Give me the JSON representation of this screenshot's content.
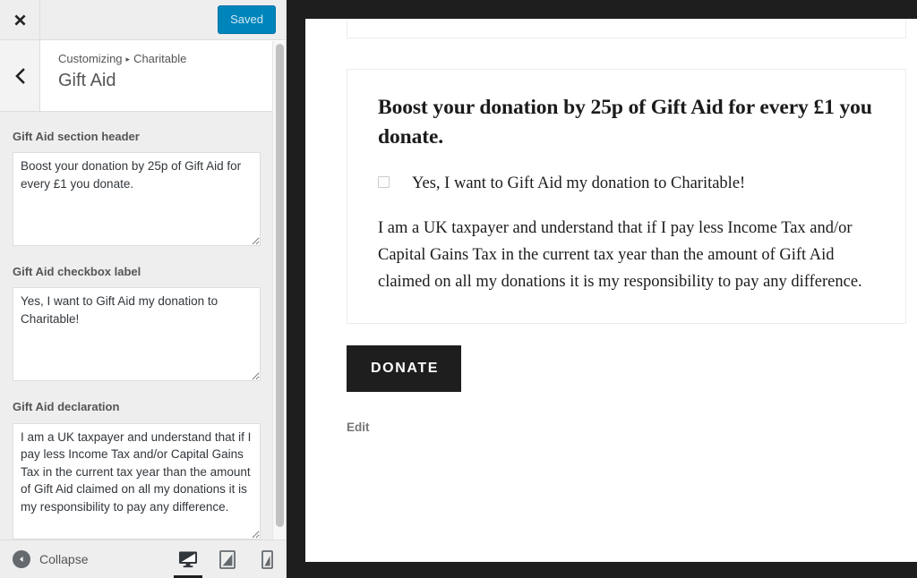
{
  "customizer": {
    "close_label": "Close",
    "back_label": "Back",
    "save_button_label": "Saved",
    "breadcrumb": {
      "root": "Customizing",
      "separator": "▸",
      "current": "Charitable"
    },
    "panel_title": "Gift Aid",
    "controls": [
      {
        "label": "Gift Aid section header",
        "value": "Boost your donation by 25p of Gift Aid for every £1 you donate.",
        "placeholder": ""
      },
      {
        "label": "Gift Aid checkbox label",
        "value": "Yes, I want to Gift Aid my donation to Charitable!",
        "placeholder": ""
      },
      {
        "label": "Gift Aid declaration",
        "value": "I am a UK taxpayer and understand that if I pay less Income Tax and/or Capital Gains Tax in the current tax year than the amount of Gift Aid claimed on all my donations it is my responsibility to pay any difference.",
        "placeholder": ""
      }
    ],
    "footer": {
      "collapse_label": "Collapse",
      "devices": [
        {
          "name": "desktop",
          "label": "Enter desktop preview mode",
          "active": true
        },
        {
          "name": "tablet",
          "label": "Enter tablet preview mode",
          "active": false
        },
        {
          "name": "mobile",
          "label": "Enter mobile preview mode",
          "active": false
        }
      ]
    },
    "accent_color": "#0085ba",
    "save_text_color": "#cfe8f4"
  },
  "preview": {
    "gift_aid_heading": "Boost your donation by 25p of Gift Aid for every £1 you donate.",
    "gift_aid_checkbox_label": "Yes, I want to Gift Aid my donation to Charitable!",
    "gift_aid_declaration": "I am a UK taxpayer and understand that if I pay less Income Tax and/or Capital Gains Tax in the current tax year than the amount of Gift Aid claimed on all my donations it is my responsibility to pay any difference.",
    "donate_button_label": "DONATE",
    "edit_link_label": "Edit",
    "donate_button_color": "#1e1e1e",
    "frame_color": "#1e1e1e"
  }
}
